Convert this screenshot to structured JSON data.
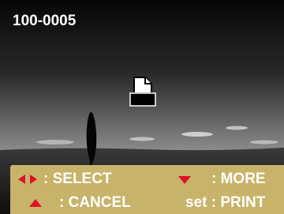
{
  "screen": {
    "counter": "100-0005",
    "icon": "print-icon"
  },
  "legend": {
    "select_label": ": SELECT",
    "more_label": ": MORE",
    "cancel_label": ": CANCEL",
    "print_label": "set : PRINT",
    "arrow_color": "#e0102a",
    "bar_color": "#c8b36a"
  }
}
